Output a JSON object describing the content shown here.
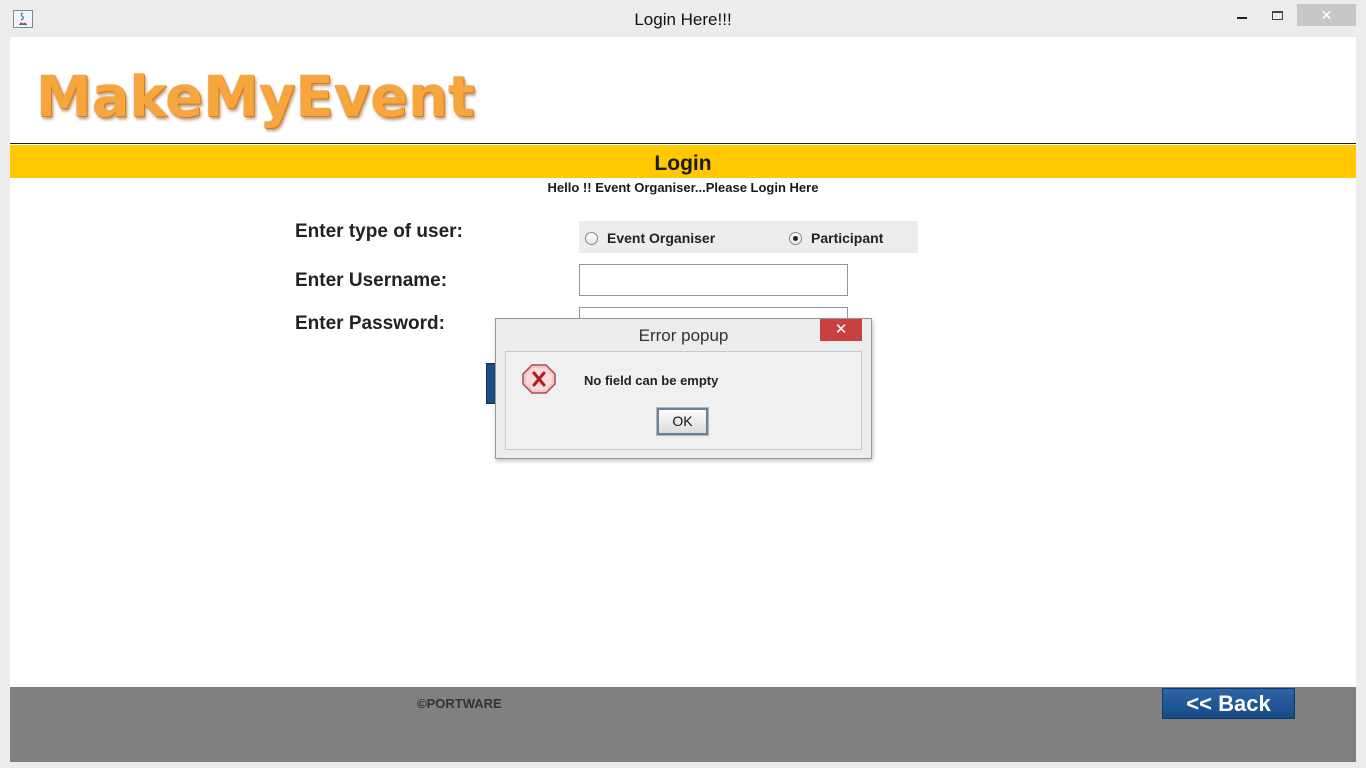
{
  "window": {
    "title": "Login Here!!!",
    "close_glyph": "✕"
  },
  "brand": {
    "logo_text": "MakeMyEvent",
    "logo_color": "#f6a63d"
  },
  "login": {
    "banner": "Login",
    "banner_color": "#ffc800",
    "greeting": "Hello !! Event Organiser...Please Login Here",
    "user_type_label": "Enter type of user:",
    "username_label": "Enter Username:",
    "password_label": "Enter Password:",
    "user_types": [
      {
        "label": "Event Organiser",
        "checked": false
      },
      {
        "label": "Participant",
        "checked": true
      }
    ],
    "username_value": "",
    "password_value": ""
  },
  "footer": {
    "copyright": "©PORTWARE",
    "back_label": "<< Back",
    "back_color": "#1f5796"
  },
  "error_dialog": {
    "title": "Error popup",
    "close_glyph": "✕",
    "message": "No field can be empty",
    "ok_label": "OK",
    "icon": "error-x-icon"
  }
}
